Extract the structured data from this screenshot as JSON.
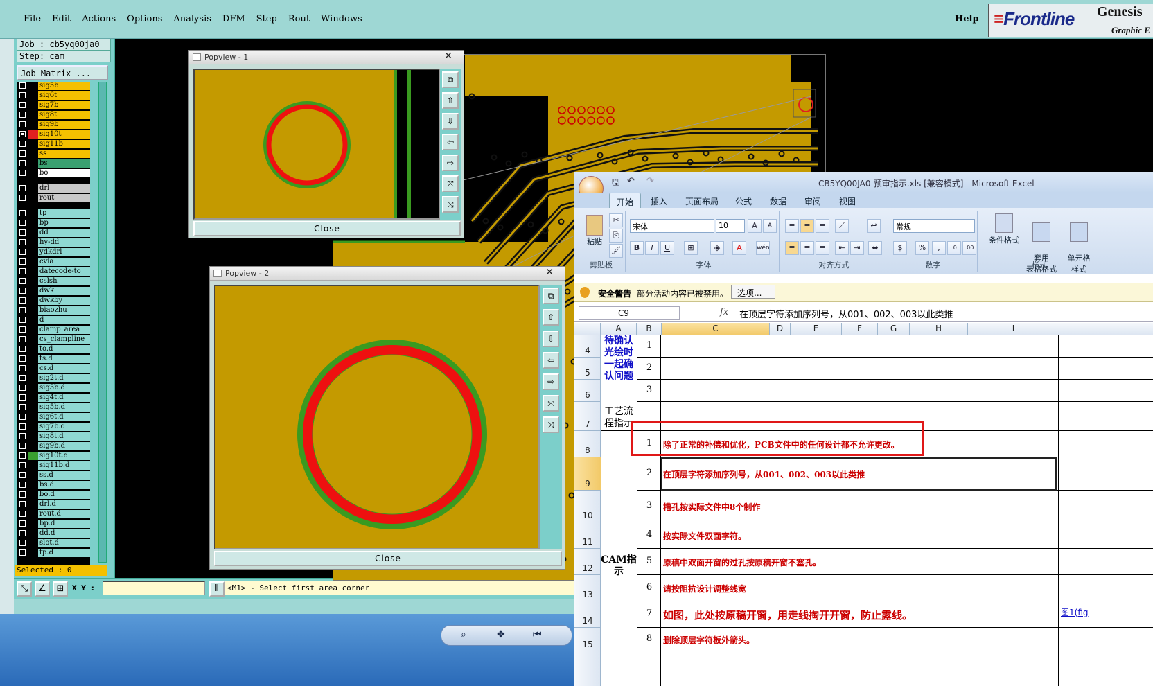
{
  "genesis": {
    "menu": [
      "File",
      "Edit",
      "Actions",
      "Options",
      "Analysis",
      "DFM",
      "Step",
      "Rout",
      "Windows"
    ],
    "help": "Help",
    "logo_main": "Frontline",
    "logo_genesis": "Genesis",
    "logo_sub": "Graphic E",
    "job_line": "Job : cb5yq00ja0",
    "step_line": "Step: cam",
    "job_matrix": "Job Matrix ...",
    "selected": "Selected : 0",
    "xy_label": "X Y :",
    "status_msg": "<M1> - Select first area corner",
    "layers": [
      {
        "name": "sig5b",
        "color": "#f4c000",
        "on": false
      },
      {
        "name": "sig6t",
        "color": "#f4c000",
        "on": false
      },
      {
        "name": "sig7b",
        "color": "#f4c000",
        "on": false
      },
      {
        "name": "sig8t",
        "color": "#f4c000",
        "on": false
      },
      {
        "name": "sig9b",
        "color": "#f4c000",
        "on": false
      },
      {
        "name": "sig10t",
        "color": "#f4c000",
        "on": true,
        "sw": "#e02020"
      },
      {
        "name": "sig11b",
        "color": "#f4c000",
        "on": false
      },
      {
        "name": "ss",
        "color": "#f4c000",
        "on": false
      },
      {
        "name": "bs",
        "color": "#3aa070",
        "on": false
      },
      {
        "name": "bo",
        "color": "#ffffff",
        "on": false
      },
      {
        "gap": true
      },
      {
        "name": "drl",
        "color": "#c8c8c8",
        "on": false
      },
      {
        "name": "rout",
        "color": "#c8c8c8",
        "on": false
      },
      {
        "gap": true
      },
      {
        "name": "tp",
        "color": "#8fd8d2",
        "on": false
      },
      {
        "name": "bp",
        "color": "#8fd8d2",
        "on": false
      },
      {
        "name": "dd",
        "color": "#8fd8d2",
        "on": false
      },
      {
        "name": "hy-dd",
        "color": "#8fd8d2",
        "on": false
      },
      {
        "name": "ydkdrl",
        "color": "#8fd8d2",
        "on": false
      },
      {
        "name": "cvia",
        "color": "#8fd8d2",
        "on": false
      },
      {
        "name": "datecode-to",
        "color": "#8fd8d2",
        "on": false
      },
      {
        "name": "cslsh",
        "color": "#8fd8d2",
        "on": false
      },
      {
        "name": "dwk",
        "color": "#8fd8d2",
        "on": false
      },
      {
        "name": "dwkby",
        "color": "#8fd8d2",
        "on": false
      },
      {
        "name": "biaozhu",
        "color": "#8fd8d2",
        "on": false
      },
      {
        "name": "d",
        "color": "#8fd8d2",
        "on": false
      },
      {
        "name": "clamp_area",
        "color": "#8fd8d2",
        "on": false
      },
      {
        "name": "cs_clampline",
        "color": "#8fd8d2",
        "on": false
      },
      {
        "name": "to.d",
        "color": "#8fd8d2",
        "on": false
      },
      {
        "name": "ts.d",
        "color": "#8fd8d2",
        "on": false
      },
      {
        "name": "cs.d",
        "color": "#8fd8d2",
        "on": false
      },
      {
        "name": "sig2t.d",
        "color": "#8fd8d2",
        "on": false
      },
      {
        "name": "sig3b.d",
        "color": "#8fd8d2",
        "on": false
      },
      {
        "name": "sig4t.d",
        "color": "#8fd8d2",
        "on": false
      },
      {
        "name": "sig5b.d",
        "color": "#8fd8d2",
        "on": false
      },
      {
        "name": "sig6t.d",
        "color": "#8fd8d2",
        "on": false
      },
      {
        "name": "sig7b.d",
        "color": "#8fd8d2",
        "on": false
      },
      {
        "name": "sig8t.d",
        "color": "#8fd8d2",
        "on": false
      },
      {
        "name": "sig9b.d",
        "color": "#8fd8d2",
        "on": false
      },
      {
        "name": "sig10t.d",
        "color": "#8fd8d2",
        "on": false,
        "sw": "#3aa030"
      },
      {
        "name": "sig11b.d",
        "color": "#8fd8d2",
        "on": false
      },
      {
        "name": "ss.d",
        "color": "#8fd8d2",
        "on": false
      },
      {
        "name": "bs.d",
        "color": "#8fd8d2",
        "on": false
      },
      {
        "name": "bo.d",
        "color": "#8fd8d2",
        "on": false
      },
      {
        "name": "drl.d",
        "color": "#8fd8d2",
        "on": false
      },
      {
        "name": "rout.d",
        "color": "#8fd8d2",
        "on": false
      },
      {
        "name": "bp.d",
        "color": "#8fd8d2",
        "on": false
      },
      {
        "name": "dd.d",
        "color": "#8fd8d2",
        "on": false
      },
      {
        "name": "slot.d",
        "color": "#8fd8d2",
        "on": false
      },
      {
        "name": "tp.d",
        "color": "#8fd8d2",
        "on": false
      }
    ]
  },
  "popview1": {
    "title": "Popview - 1",
    "close": "Close"
  },
  "popview2": {
    "title": "Popview - 2",
    "close": "Close"
  },
  "excel": {
    "title": "CB5YQ00JA0-预审指示.xls  [兼容模式]  -  Microsoft Excel",
    "tabs": [
      "开始",
      "插入",
      "页面布局",
      "公式",
      "数据",
      "审阅",
      "视图"
    ],
    "groups": {
      "clipboard": "剪贴板",
      "font": "字体",
      "align": "对齐方式",
      "number": "数字",
      "styles": "样式"
    },
    "paste": "粘贴",
    "font_name": "宋体",
    "font_size": "10",
    "number_format": "常规",
    "style_btns": [
      "条件格式",
      "套用\n表格格式",
      "单元格\n样式"
    ],
    "security_title": "安全警告",
    "security_msg": "部分活动内容已被禁用。",
    "security_btn": "选项...",
    "name_box": "C9",
    "formula": "在顶层字符添加序列号，从001、002、003以此类推",
    "columns": [
      "A",
      "B",
      "C",
      "D",
      "E",
      "F",
      "G",
      "H",
      "I"
    ],
    "rows": [
      "4",
      "5",
      "6",
      "7",
      "8",
      "9",
      "10",
      "11",
      "12",
      "13",
      "14",
      "15"
    ],
    "a_confirm": "待确认光绘时一起确认问题",
    "a_flow": "工艺流程指示",
    "a_cam": "CAM指示",
    "b_confirm": [
      "1",
      "2",
      "3"
    ],
    "items": [
      {
        "n": "1",
        "text": "除了正常的补偿和优化，PCB文件中的任何设计都不允许更改。"
      },
      {
        "n": "2",
        "text": "在顶层字符添加序列号，从001、002、003以此类推"
      },
      {
        "n": "3",
        "text": "槽孔按实际文件中8个制作"
      },
      {
        "n": "4",
        "text": "按实际文件双面字符。"
      },
      {
        "n": "5",
        "text": "原稿中双面开窗的过孔按原稿开窗不塞孔。"
      },
      {
        "n": "6",
        "text": "请按阻抗设计调整线宽"
      },
      {
        "n": "7",
        "text": "如图，此处按原稿开窗，用走线掏开开窗，防止露线。"
      },
      {
        "n": "8",
        "text": "删除顶层字符板外箭头。"
      }
    ],
    "fig_link": "图1(fig"
  }
}
